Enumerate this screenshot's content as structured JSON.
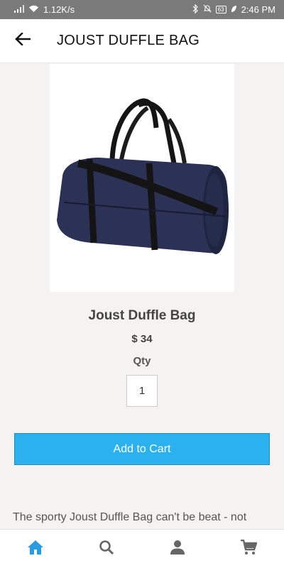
{
  "status_bar": {
    "network_speed": "1.12K/s",
    "battery": "63",
    "time": "2:46 PM"
  },
  "app_bar": {
    "title": "JOUST DUFFLE BAG",
    "back_icon": "arrow-left-icon"
  },
  "product": {
    "image_alt": "duffle-bag-image",
    "name": "Joust Duffle Bag",
    "price": "$ 34",
    "qty_label": "Qty",
    "qty_value": "1",
    "add_to_cart_label": "Add to Cart",
    "description": "The sporty Joust Duffle Bag can't be beat - not"
  },
  "bottom_nav": {
    "items": [
      {
        "icon": "home-icon",
        "active": true
      },
      {
        "icon": "search-icon",
        "active": false
      },
      {
        "icon": "account-icon",
        "active": false
      },
      {
        "icon": "cart-icon",
        "active": false
      }
    ]
  },
  "colors": {
    "accent": "#2bb1f0",
    "nav_active": "#2a9be0",
    "nav_inactive": "#666666",
    "status_bar_bg": "#7a7a7a"
  }
}
